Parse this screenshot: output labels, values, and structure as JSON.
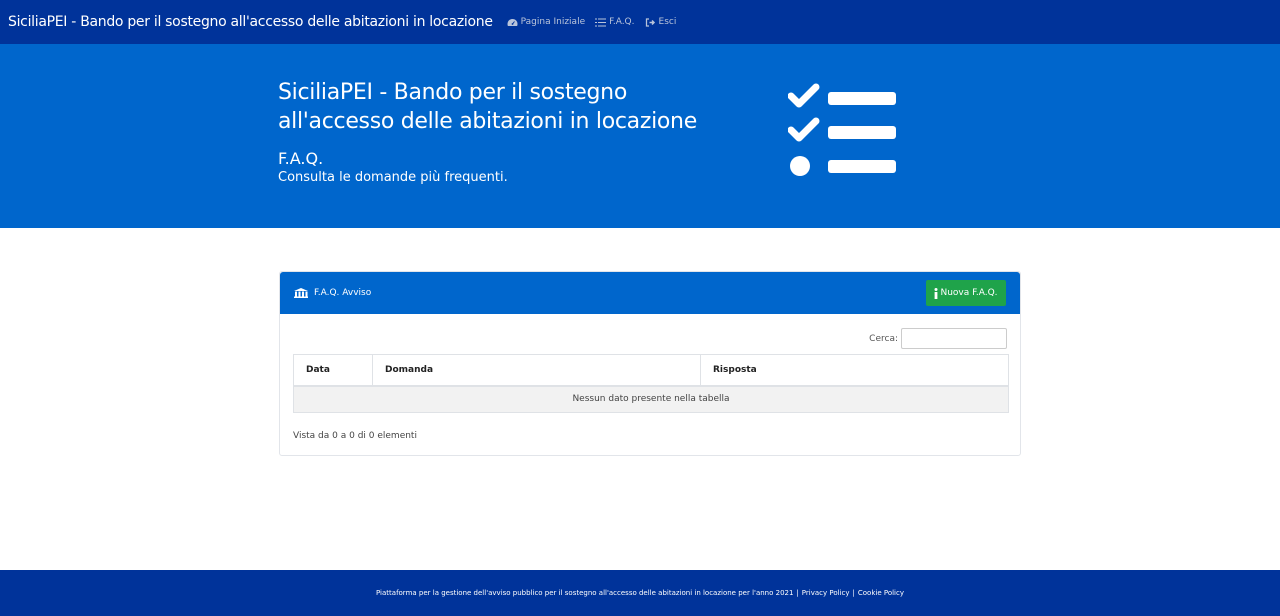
{
  "nav": {
    "brand": "SiciliaPEI - Bando per il sostegno all'accesso delle abitazioni in locazione",
    "links": [
      {
        "label": "Pagina Iniziale",
        "icon": "dashboard-icon"
      },
      {
        "label": "F.A.Q.",
        "icon": "list-icon"
      },
      {
        "label": "Esci",
        "icon": "sign-out-icon"
      }
    ]
  },
  "hero": {
    "title": "SiciliaPEI - Bando per il sostegno all'accesso delle abitazioni in locazione",
    "subtitle": "F.A.Q.",
    "description": "Consulta le domande più frequenti.",
    "icon": "checklist-icon"
  },
  "card": {
    "title": "F.A.Q. Avviso",
    "new_button": "Nuova F.A.Q.",
    "search_label": "Cerca:",
    "search_value": "",
    "columns": [
      "Data",
      "Domanda",
      "Risposta"
    ],
    "empty_message": "Nessun dato presente nella tabella",
    "info": "Vista da 0 a 0 di 0 elementi"
  },
  "footer": {
    "text": "Piattaforma per la gestione dell'avviso pubblico per il sostegno all'accesso delle abitazioni in locazione per l'anno 2021",
    "privacy": "Privacy Policy",
    "cookie": "Cookie Policy",
    "separator": "|"
  },
  "colors": {
    "nav_bg": "#00339a",
    "hero_bg": "#0066cc",
    "button_green": "#1fa34a",
    "footer_bg": "#00339a"
  }
}
